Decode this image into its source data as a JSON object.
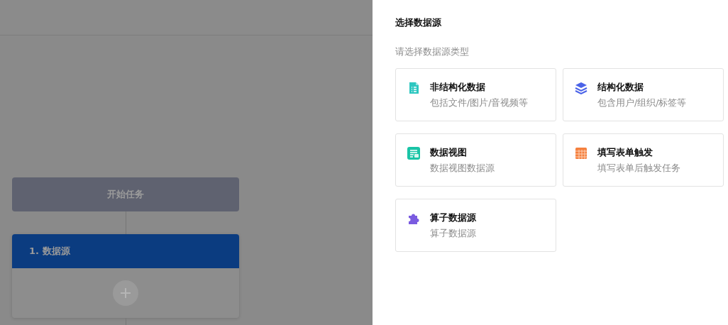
{
  "flow": {
    "start_node": "开始任务",
    "step_node": {
      "title": "1. 数据源"
    }
  },
  "drawer": {
    "title": "选择数据源",
    "subtitle": "请选择数据源类型",
    "sources": [
      {
        "kind": "file",
        "title": "非结构化数据",
        "description": "包括文件/图片/音视频等"
      },
      {
        "kind": "layers",
        "title": "结构化数据",
        "description": "包含用户/组织/标签等"
      },
      {
        "kind": "view",
        "title": "数据视图",
        "description": "数据视图数据源"
      },
      {
        "kind": "form",
        "title": "填写表单触发",
        "description": "填写表单后触发任务"
      },
      {
        "kind": "operator",
        "title": "算子数据源",
        "description": "算子数据源"
      }
    ]
  }
}
